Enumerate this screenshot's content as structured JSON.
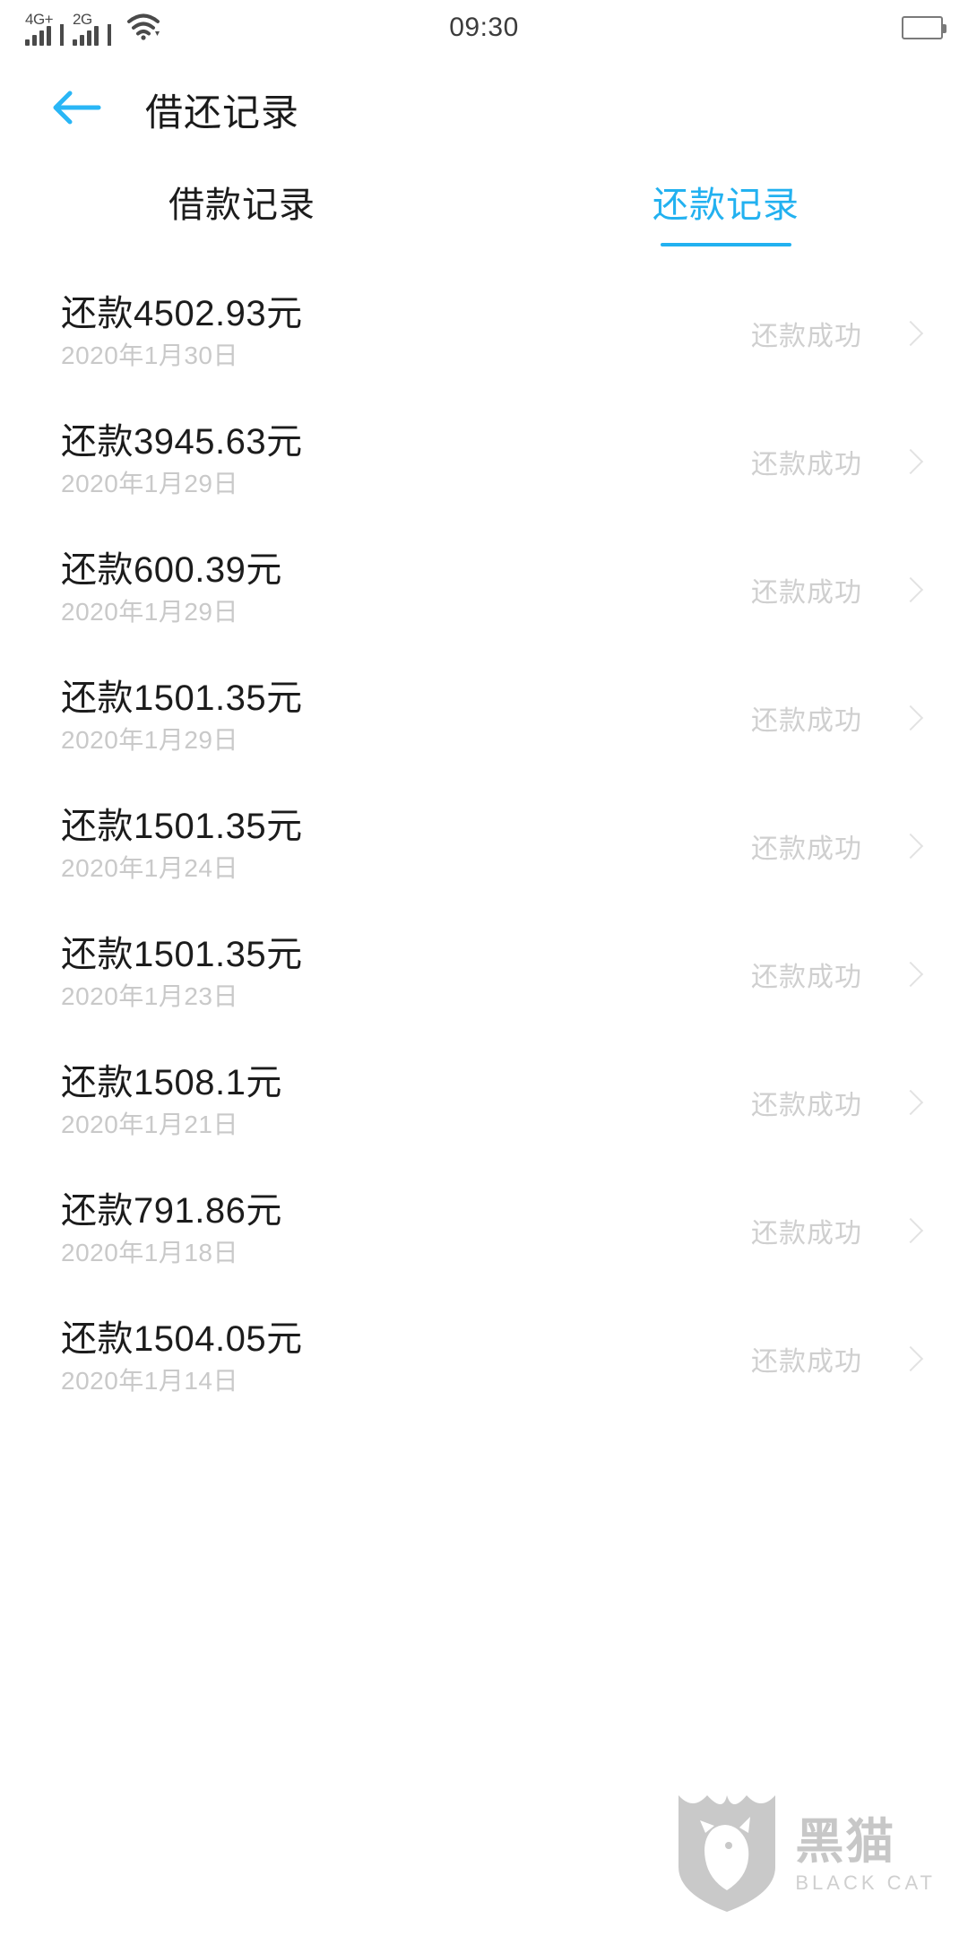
{
  "status_bar": {
    "signal_1_label": "4G+",
    "signal_2_label": "2G",
    "time": "09:30",
    "wifi_icon": "wifi-icon",
    "battery_icon": "battery-icon"
  },
  "header": {
    "back_icon": "back-arrow-icon",
    "title": "借还记录",
    "accent_color": "#22b1f0"
  },
  "tabs": [
    {
      "label": "借款记录",
      "active": false
    },
    {
      "label": "还款记录",
      "active": true
    }
  ],
  "records": [
    {
      "amount": "还款4502.93元",
      "date": "2020年1月30日",
      "status": "还款成功"
    },
    {
      "amount": "还款3945.63元",
      "date": "2020年1月29日",
      "status": "还款成功"
    },
    {
      "amount": "还款600.39元",
      "date": "2020年1月29日",
      "status": "还款成功"
    },
    {
      "amount": "还款1501.35元",
      "date": "2020年1月29日",
      "status": "还款成功"
    },
    {
      "amount": "还款1501.35元",
      "date": "2020年1月24日",
      "status": "还款成功"
    },
    {
      "amount": "还款1501.35元",
      "date": "2020年1月23日",
      "status": "还款成功"
    },
    {
      "amount": "还款1508.1元",
      "date": "2020年1月21日",
      "status": "还款成功"
    },
    {
      "amount": "还款791.86元",
      "date": "2020年1月18日",
      "status": "还款成功"
    },
    {
      "amount": "还款1504.05元",
      "date": "2020年1月14日",
      "status": "还款成功"
    }
  ],
  "watermark": {
    "logo_icon": "black-cat-shield-icon",
    "name_cn": "黑猫",
    "name_en": "BLACK CAT"
  }
}
